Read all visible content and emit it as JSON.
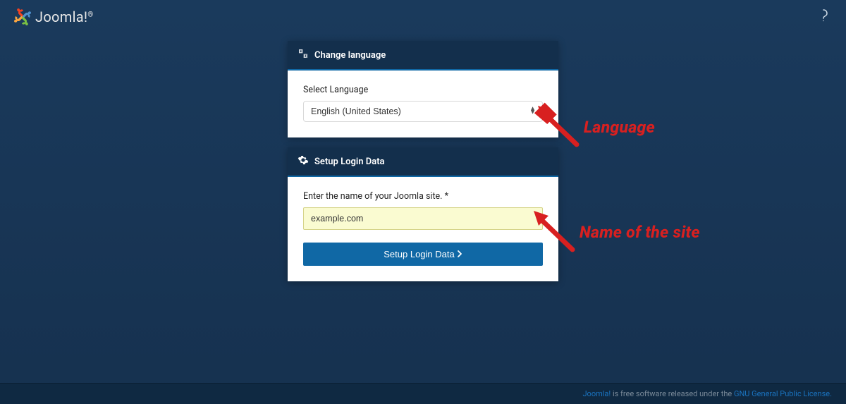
{
  "header": {
    "brand": "Joomla!",
    "brandSuperscript": "®"
  },
  "cards": {
    "language": {
      "title": "Change language",
      "label": "Select Language",
      "selected": "English (United States)"
    },
    "setup": {
      "title": "Setup Login Data",
      "label": "Enter the name of your Joomla site. *",
      "value": "example.com",
      "buttonLabel": "Setup Login Data"
    }
  },
  "annotations": {
    "language": "Language",
    "siteName": "Name of the site"
  },
  "footer": {
    "linkBrand": "Joomla!",
    "text1": " is free software released under the ",
    "linkLicense": "GNU General Public License."
  }
}
